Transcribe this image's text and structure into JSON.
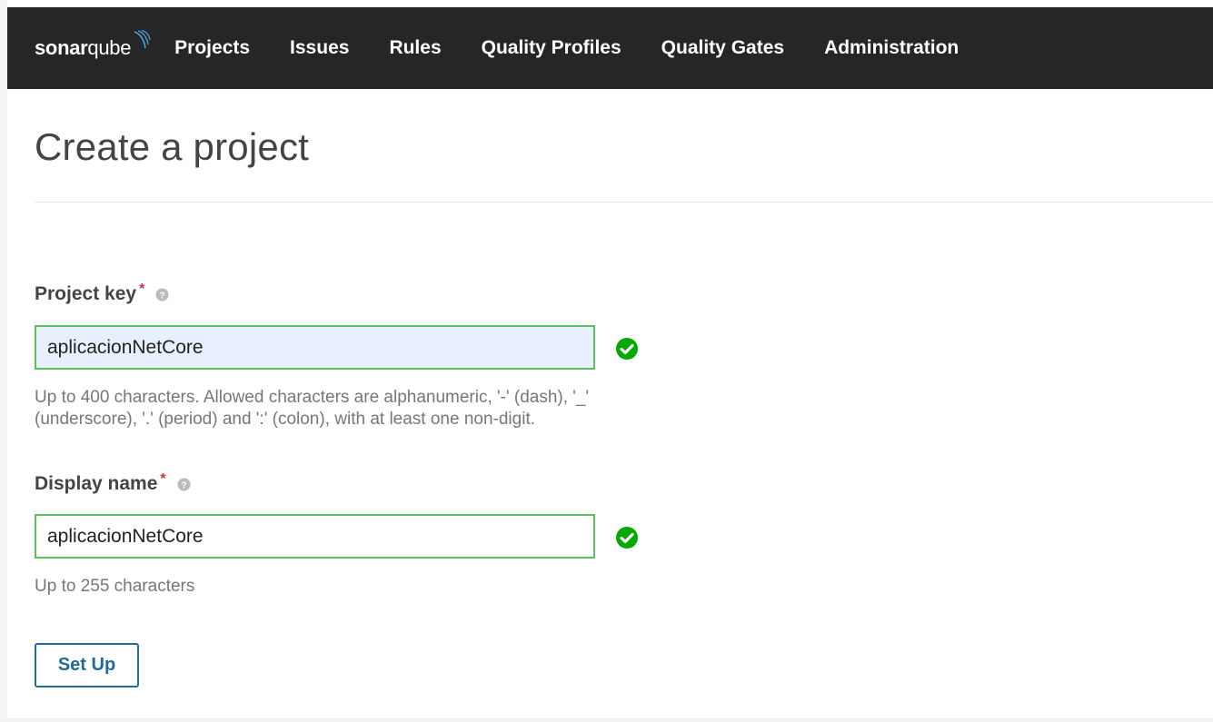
{
  "nav": {
    "logo_bold": "sonar",
    "logo_light": "qube",
    "items": [
      {
        "label": "Projects"
      },
      {
        "label": "Issues"
      },
      {
        "label": "Rules"
      },
      {
        "label": "Quality Profiles"
      },
      {
        "label": "Quality Gates"
      },
      {
        "label": "Administration"
      }
    ]
  },
  "page": {
    "title": "Create a project"
  },
  "form": {
    "project_key": {
      "label": "Project key",
      "required_mark": "*",
      "value": "aplicacionNetCore",
      "hint_line1": "Up to 400 characters. Allowed characters are alphanumeric, '-' (dash), '_'",
      "hint_line2": "(underscore), '.' (period) and ':' (colon), with at least one non-digit.",
      "status_icon": "check-circle-icon",
      "valid": true
    },
    "display_name": {
      "label": "Display name",
      "required_mark": "*",
      "value": "aplicacionNetCore",
      "hint": "Up to 255 characters",
      "status_icon": "check-circle-icon",
      "valid": true
    },
    "submit_label": "Set Up"
  },
  "colors": {
    "navbar": "#262626",
    "valid_border": "#5cc05c",
    "valid_icon": "#00aa00",
    "button": "#236a97",
    "required": "#d4333f",
    "autofill_bg": "#e8f0fe"
  }
}
